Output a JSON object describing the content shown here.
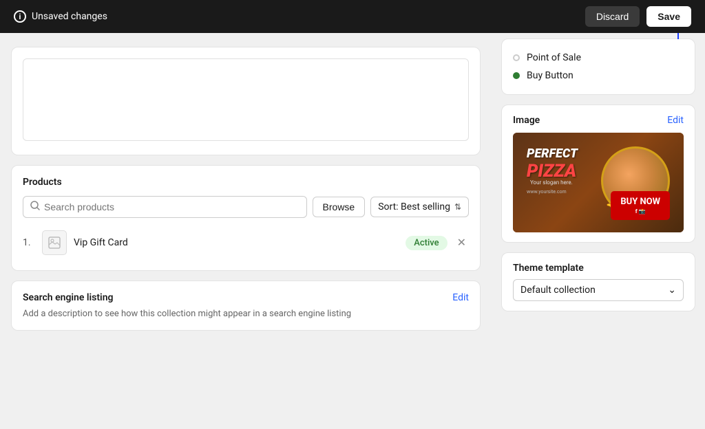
{
  "topbar": {
    "unsaved_label": "Unsaved changes",
    "discard_label": "Discard",
    "save_label": "Save"
  },
  "left": {
    "textarea_placeholder": "",
    "products_section": {
      "title": "Products",
      "search_placeholder": "Search products",
      "browse_label": "Browse",
      "sort_label": "Sort: Best selling",
      "items": [
        {
          "num": "1.",
          "name": "Vip Gift Card",
          "status": "Active"
        }
      ]
    },
    "seo_section": {
      "title": "Search engine listing",
      "edit_label": "Edit",
      "description": "Add a description to see how this collection might appear in a search engine listing"
    }
  },
  "right": {
    "channels": {
      "items": [
        {
          "label": "Point of Sale",
          "dot_type": "empty"
        },
        {
          "label": "Buy Button",
          "dot_type": "green"
        }
      ]
    },
    "image": {
      "title": "Image",
      "edit_label": "Edit",
      "alt_text": "Perfect Pizza banner with buy now button"
    },
    "theme": {
      "title": "Theme template",
      "default_label": "Default collection"
    }
  }
}
